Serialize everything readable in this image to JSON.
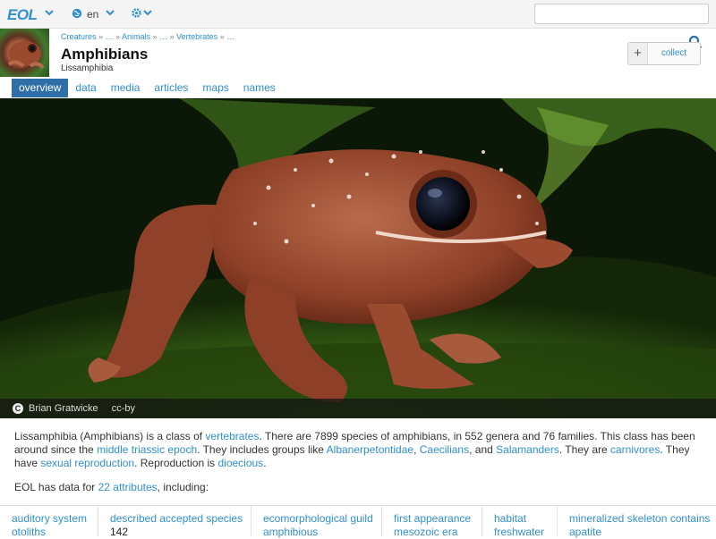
{
  "topbar": {
    "logo": "EOL",
    "language": "en",
    "search_placeholder": ""
  },
  "header": {
    "breadcrumb": [
      "Creatures",
      "…",
      "Animals",
      "…",
      "Vertebrates",
      "…"
    ],
    "title": "Amphibians",
    "subtitle": "Lissamphibia",
    "collect_label": "collect",
    "collect_plus": "+"
  },
  "tabs": [
    "overview",
    "data",
    "media",
    "articles",
    "maps",
    "names"
  ],
  "hero": {
    "credit_author": "Brian Gratwicke",
    "credit_license": "cc-by",
    "cc_symbol": "C"
  },
  "summary": {
    "p1": "Lissamphibia (Amphibians) is a class of ",
    "link_vertebrates": "vertebrates",
    "p2": ". There are 7899 species of amphibians, in 552 genera and 76 families. This class has been around since the ",
    "link_triassic": "middle triassic epoch",
    "p3": ". They includes groups like ",
    "link_albanerpetontidae": "Albanerpetontidae",
    "p4": ", ",
    "link_caecilians": "Caecilians",
    "p5": ", and ",
    "link_salamanders": "Salamanders",
    "p6": ". They are ",
    "link_carnivores": "carnivores",
    "p7": ". They have ",
    "link_sexual": "sexual reproduction",
    "p8": ". Reproduction is ",
    "link_dioecious": "dioecious",
    "p9": "."
  },
  "attributes": {
    "prefix": "EOL has data for ",
    "count_link": "22 attributes",
    "suffix": ", including:",
    "cells": [
      {
        "name": "auditory system",
        "value": "otoliths",
        "value_is_link": true
      },
      {
        "name": "described accepted species",
        "value": "142",
        "value_is_link": false
      },
      {
        "name": "ecomorphological guild",
        "value": "amphibious",
        "value_is_link": true
      },
      {
        "name": "first appearance",
        "value": "mesozoic era",
        "value_is_link": true
      },
      {
        "name": "habitat",
        "value": "freshwater",
        "value_is_link": true
      },
      {
        "name": "mineralized skeleton contains",
        "value": "apatite",
        "value_is_link": true
      }
    ]
  },
  "colors": {
    "accent": "#2f8fcf",
    "active_tab": "#2f6fa8"
  }
}
